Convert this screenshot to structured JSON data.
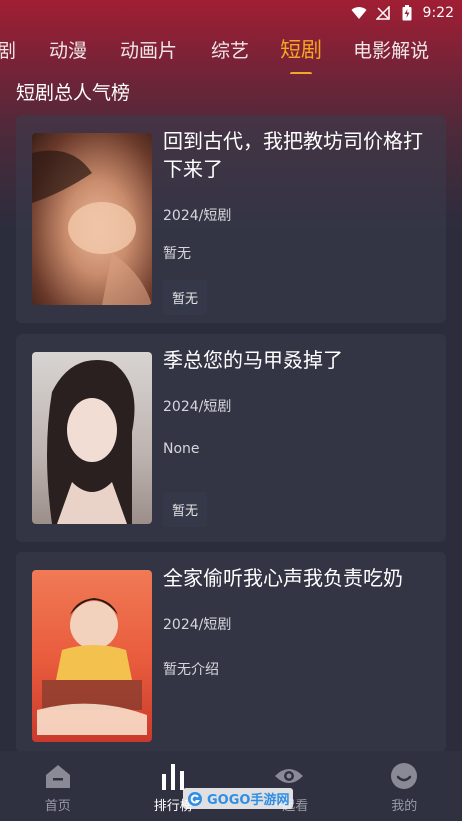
{
  "status_bar": {
    "time": "9:22"
  },
  "tabs": [
    {
      "label": "剧",
      "active": false
    },
    {
      "label": "动漫",
      "active": false
    },
    {
      "label": "动画片",
      "active": false
    },
    {
      "label": "综艺",
      "active": false
    },
    {
      "label": "短剧",
      "active": true
    },
    {
      "label": "电影解说",
      "active": false
    }
  ],
  "section_title": "短剧总人气榜",
  "cards": [
    {
      "title": "回到古代，我把教坊司价格打下来了",
      "year_type": "2024/短剧",
      "desc": "暂无",
      "tag": "暂无"
    },
    {
      "title": "季总您的马甲叒掉了",
      "year_type": "2024/短剧",
      "desc": "None",
      "tag": "暂无"
    },
    {
      "title": "全家偷听我心声我负责吃奶",
      "year_type": "2024/短剧",
      "desc": "暂无介绍",
      "tag": ""
    }
  ],
  "bottom_nav": [
    {
      "label": "首页",
      "icon": "home-icon",
      "active": false
    },
    {
      "label": "排行榜",
      "icon": "ranking-bars-icon",
      "active": true
    },
    {
      "label": "一起看",
      "icon": "eye-icon",
      "active": false
    },
    {
      "label": "我的",
      "icon": "smile-face-icon",
      "active": false
    }
  ],
  "watermark": "GOGO手游网",
  "colors": {
    "accent": "#f5a623",
    "header": "#a11e33",
    "background": "#2b2d3d"
  }
}
